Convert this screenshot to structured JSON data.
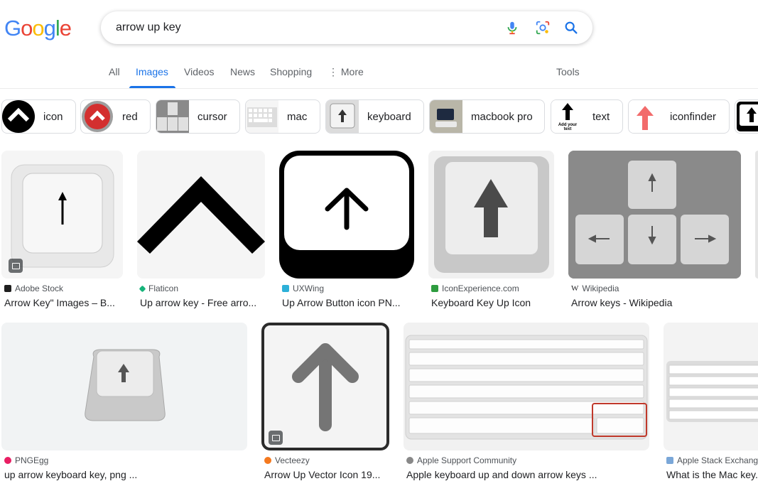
{
  "search": {
    "query": "arrow up key"
  },
  "tabs": [
    "All",
    "Images",
    "Videos",
    "News",
    "Shopping",
    "More",
    "Tools"
  ],
  "chips": [
    {
      "label": "icon"
    },
    {
      "label": "red"
    },
    {
      "label": "cursor"
    },
    {
      "label": "mac"
    },
    {
      "label": "keyboard"
    },
    {
      "label": "macbook pro"
    },
    {
      "label": "text",
      "thumb_text": "Add your text"
    },
    {
      "label": "iconfinder"
    }
  ],
  "results": [
    {
      "source": "Adobe Stock",
      "source_badge": "St",
      "title": "Arrow Key\" Images – B..."
    },
    {
      "source": "Flaticon",
      "title": "Up arrow key - Free arro..."
    },
    {
      "source": "UXWing",
      "title": "Up Arrow Button icon PN..."
    },
    {
      "source": "IconExperience.com",
      "title": "Keyboard Key Up Icon"
    },
    {
      "source": "Wikipedia",
      "source_badge": "W",
      "title": "Arrow keys - Wikipedia"
    },
    {
      "source": "PNGEgg",
      "title": "up arrow keyboard key, png ..."
    },
    {
      "source": "Vecteezy",
      "title": "Arrow Up Vector Icon 19..."
    },
    {
      "source": "Apple Support Community",
      "title": "Apple keyboard up and down arrow keys ..."
    },
    {
      "source": "Apple Stack Exchange",
      "title": "What is the Mac key..."
    }
  ],
  "colors": {
    "accent": "#1a73e8",
    "google_blue": "#4285f4",
    "google_red": "#ea4335",
    "google_yellow": "#fbbc05",
    "google_green": "#34a853"
  }
}
